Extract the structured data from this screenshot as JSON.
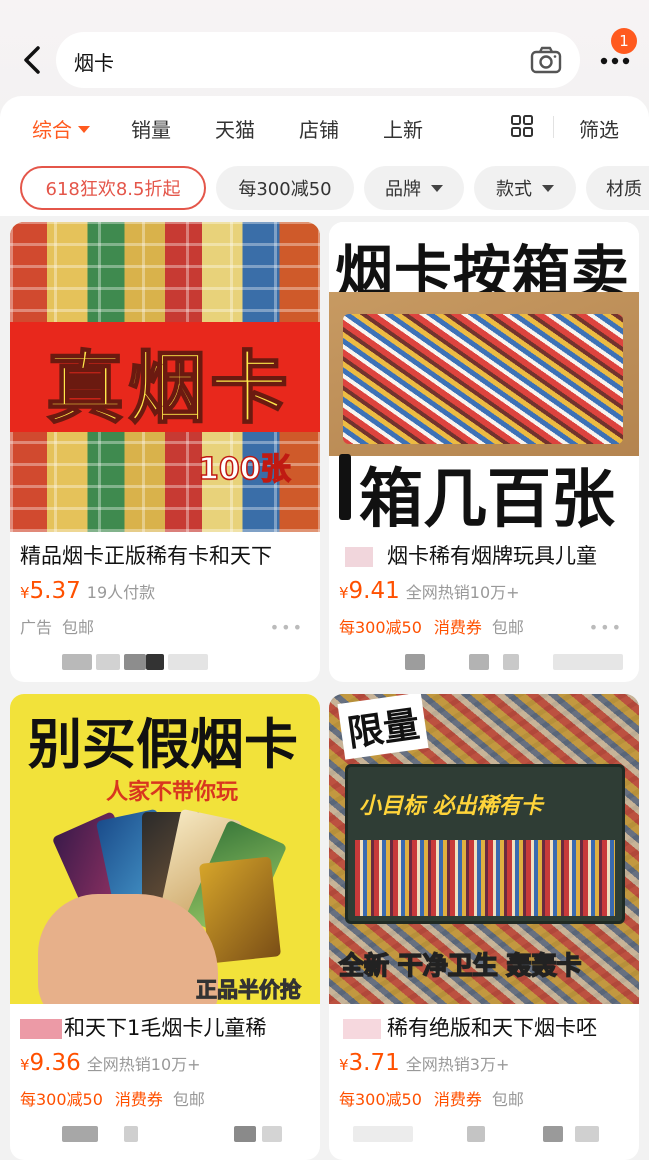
{
  "header": {
    "search_query": "烟卡",
    "notification_count": "1"
  },
  "sort_tabs": [
    {
      "label": "综合"
    },
    {
      "label": "销量"
    },
    {
      "label": "天猫"
    },
    {
      "label": "店铺"
    },
    {
      "label": "上新"
    }
  ],
  "filter_label": "筛选",
  "filter_chips": [
    {
      "label": "618狂欢8.5折起"
    },
    {
      "label": "每300减50"
    },
    {
      "label": "品牌"
    },
    {
      "label": "款式"
    },
    {
      "label": "材质"
    }
  ],
  "products": [
    {
      "image_text": [
        "真烟卡",
        "100张"
      ],
      "title": "精品烟卡正版稀有卡和天下",
      "price_symbol": "¥",
      "price": "5.37",
      "sales": "19人付款",
      "tags": [
        "广告",
        "包邮"
      ]
    },
    {
      "image_text": [
        "烟卡按箱卖",
        "箱几百张"
      ],
      "title": "烟卡稀有烟牌玩具儿童",
      "price_symbol": "¥",
      "price": "9.41",
      "sales": "全网热销10万+",
      "tags": [
        "每300减50",
        "消费券",
        "包邮"
      ]
    },
    {
      "image_text": [
        "别买假烟卡",
        "人家不带你玩",
        "正品半价抢"
      ],
      "title": "和天下1毛烟卡儿童稀",
      "price_symbol": "¥",
      "price": "9.36",
      "sales": "全网热销10万+",
      "tags": [
        "每300减50",
        "消费券",
        "包邮"
      ]
    },
    {
      "image_text": [
        "限量",
        "小目标  必出稀有卡",
        "全新 干净卫生 轰轰卡"
      ],
      "title": "稀有绝版和天下烟卡呸",
      "price_symbol": "¥",
      "price": "3.71",
      "sales": "全网热销3万+",
      "tags": [
        "每300减50",
        "消费券",
        "包邮"
      ]
    }
  ],
  "colors": {
    "accent": "#ff5000",
    "active_tab": "#ff5a1f",
    "promo_chip": "#e4564a",
    "image1_banner": "#e8281c",
    "image3_background": "#f2e23a"
  }
}
